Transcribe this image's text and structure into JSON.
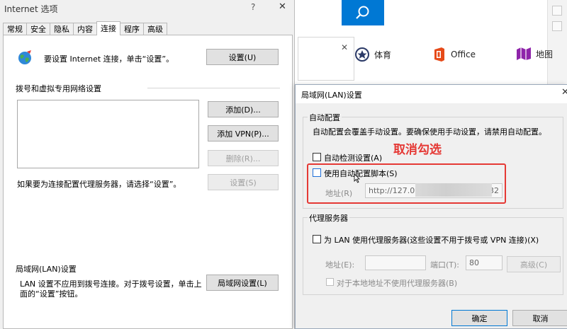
{
  "background_browser": {
    "links": [
      {
        "label": "体育",
        "icon": "sports-icon"
      },
      {
        "label": "Office",
        "icon": "office-icon"
      },
      {
        "label": "地图",
        "icon": "map-icon"
      }
    ]
  },
  "inet_window": {
    "title": "Internet 选项",
    "help": "?",
    "close": "✕",
    "tabs": [
      "常规",
      "安全",
      "隐私",
      "内容",
      "连接",
      "程序",
      "高级"
    ],
    "active_tab": "连接",
    "setup_text": "要设置 Internet 连接，单击“设置”。",
    "setup_button": "设置(U)",
    "dialup_heading": "拨号和虚拟专用网络设置",
    "add_button": "添加(D)...",
    "add_vpn_button": "添加 VPN(P)...",
    "delete_button": "删除(R)...",
    "proxy_hint": "如果要为连接配置代理服务器，请选择“设置”。",
    "settings_button": "设置(S)",
    "lan_heading": "局域网(LAN)设置",
    "lan_desc_1": "LAN 设置不应用到拨号连接。对于拨号设置，单击上",
    "lan_desc_2": "面的“设置”按钮。",
    "lan_button": "局域网设置(L)"
  },
  "lan_dialog": {
    "title": "局域网(LAN)设置",
    "close": "✕",
    "auto_group": "自动配置",
    "auto_desc": "自动配置会覆盖手动设置。要确保使用手动设置，请禁用自动配置。",
    "auto_detect": "自动检测设置(A)",
    "auto_detect_checked": false,
    "use_script": "使用自动配置脚本(S)",
    "use_script_checked": false,
    "address_label": "地址(R)",
    "address_value_start": "http://127.0.0",
    "address_value_end": "32",
    "proxy_group": "代理服务器",
    "use_proxy": "为 LAN 使用代理服务器(这些设置不用于拨号或 VPN 连接)(X)",
    "use_proxy_checked": false,
    "proxy_address_label": "地址(E):",
    "proxy_port_label": "端口(T):",
    "proxy_port_value": "80",
    "advanced_button": "高级(C)",
    "bypass_local": "对于本地地址不使用代理服务器(B)",
    "ok_button": "确定",
    "cancel_button": "取消"
  },
  "annotation": {
    "text": "取消勾选",
    "color": "#e53935"
  },
  "colors": {
    "accent": "#0078d4",
    "annotation": "#e53935"
  }
}
